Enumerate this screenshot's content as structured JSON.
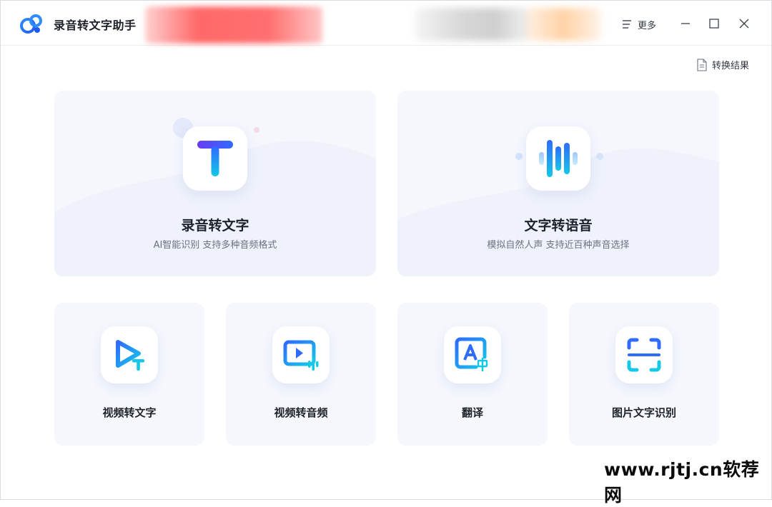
{
  "app": {
    "title": "录音转文字助手",
    "more_label": "更多"
  },
  "toolbar": {
    "result_label": "转换结果"
  },
  "features_main": [
    {
      "title": "录音转文字",
      "desc": "AI智能识别 支持多种音频格式",
      "icon": "text-t-icon"
    },
    {
      "title": "文字转语音",
      "desc": "模拟自然人声 支持近百种声音选择",
      "icon": "soundwave-icon"
    }
  ],
  "features_small": [
    {
      "title": "视频转文字",
      "icon": "video-to-text-icon"
    },
    {
      "title": "视频转音频",
      "icon": "video-to-audio-icon"
    },
    {
      "title": "翻译",
      "icon": "translate-icon"
    },
    {
      "title": "图片文字识别",
      "icon": "scan-ocr-icon"
    }
  ],
  "watermark": "www.rjtj.cn软荐网",
  "colors": {
    "accent_blue": "#2f6bff",
    "accent_cyan": "#14c8e6",
    "accent_purple": "#6a3cf0",
    "card_bg": "#f5f7fd"
  }
}
